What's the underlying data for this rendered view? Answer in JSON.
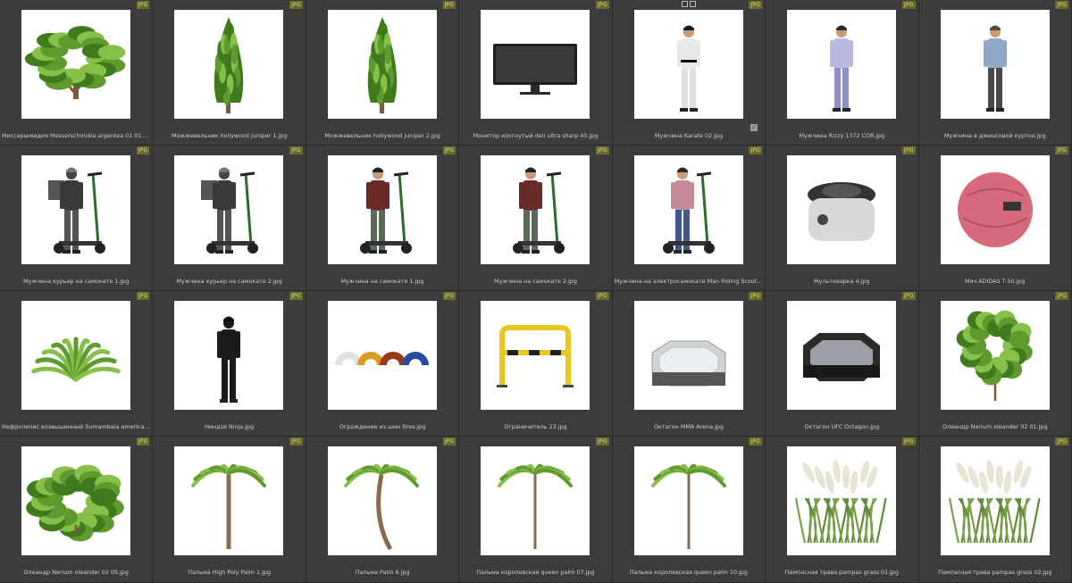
{
  "badge_text": "JPG",
  "items": [
    {
      "label": "Миссершмидия Messerschmidia argentea 01 01.jpg",
      "icon": "shrub-icon"
    },
    {
      "label": "Можжевельник hollywood juniper 1.jpg",
      "icon": "juniper-tree-icon"
    },
    {
      "label": "Можжевельник hollywood juniper 2.jpg",
      "icon": "juniper-tree-icon"
    },
    {
      "label": "Монитор изогнутый dell ultra sharp 40.jpg",
      "icon": "monitor-icon"
    },
    {
      "label": "Мужчина Karate 02.jpg",
      "icon": "karate-man-icon"
    },
    {
      "label": "Мужчина Rizzy 1372 COR.jpg",
      "icon": "man-phone-icon"
    },
    {
      "label": "Мужчина в джинсовой куртке.jpg",
      "icon": "man-jacket-icon"
    },
    {
      "label": "Мужчина курьер на самокате 1.jpg",
      "icon": "courier-scooter-icon"
    },
    {
      "label": "Мужчина курьер на самокате 2.jpg",
      "icon": "courier-scooter-icon"
    },
    {
      "label": "Мужчина на самокате 1.jpg",
      "icon": "man-scooter-icon"
    },
    {
      "label": "Мужчина на самокате 2.jpg",
      "icon": "man-scooter-icon"
    },
    {
      "label": "Мужчина на электросамокате Man Riding Scooter With C...",
      "icon": "man-escooter-icon"
    },
    {
      "label": "Мультиварка 4.jpg",
      "icon": "multicooker-icon"
    },
    {
      "label": "Мяч ADIDAS T-50.jpg",
      "icon": "ball-icon"
    },
    {
      "label": "Нефролепис возвышенный Sumambaia americana Nephr...",
      "icon": "fern-icon"
    },
    {
      "label": "Ниндзя Ninja.jpg",
      "icon": "ninja-icon"
    },
    {
      "label": "Ограждение из шин tires.jpg",
      "icon": "tires-icon"
    },
    {
      "label": "Ограничитель 23.jpg",
      "icon": "barrier-icon"
    },
    {
      "label": "Октагон MMA Arena.jpg",
      "icon": "octagon-arena-icon"
    },
    {
      "label": "Октагон UFC Octagon.jpg",
      "icon": "octagon-ufc-icon"
    },
    {
      "label": "Олеандр Nerium oleander 02 01.jpg",
      "icon": "oleander-icon"
    },
    {
      "label": "Олеандр Nerium oleander 02 05.jpg",
      "icon": "oleander-bush-icon"
    },
    {
      "label": "Пальма High Poly Palm 1.jpg",
      "icon": "palm-icon"
    },
    {
      "label": "Пальма Palm 6.jpg",
      "icon": "palm-curved-icon"
    },
    {
      "label": "Пальма королевская queen palm 07.jpg",
      "icon": "queen-palm-icon"
    },
    {
      "label": "Пальма королевская queen palm 10.jpg",
      "icon": "queen-palm-icon"
    },
    {
      "label": "Пампасная трава pampas grass 01.jpg",
      "icon": "pampas-grass-icon"
    },
    {
      "label": "Пампасная трава pampas grass 02.jpg",
      "icon": "pampas-grass-icon"
    }
  ]
}
